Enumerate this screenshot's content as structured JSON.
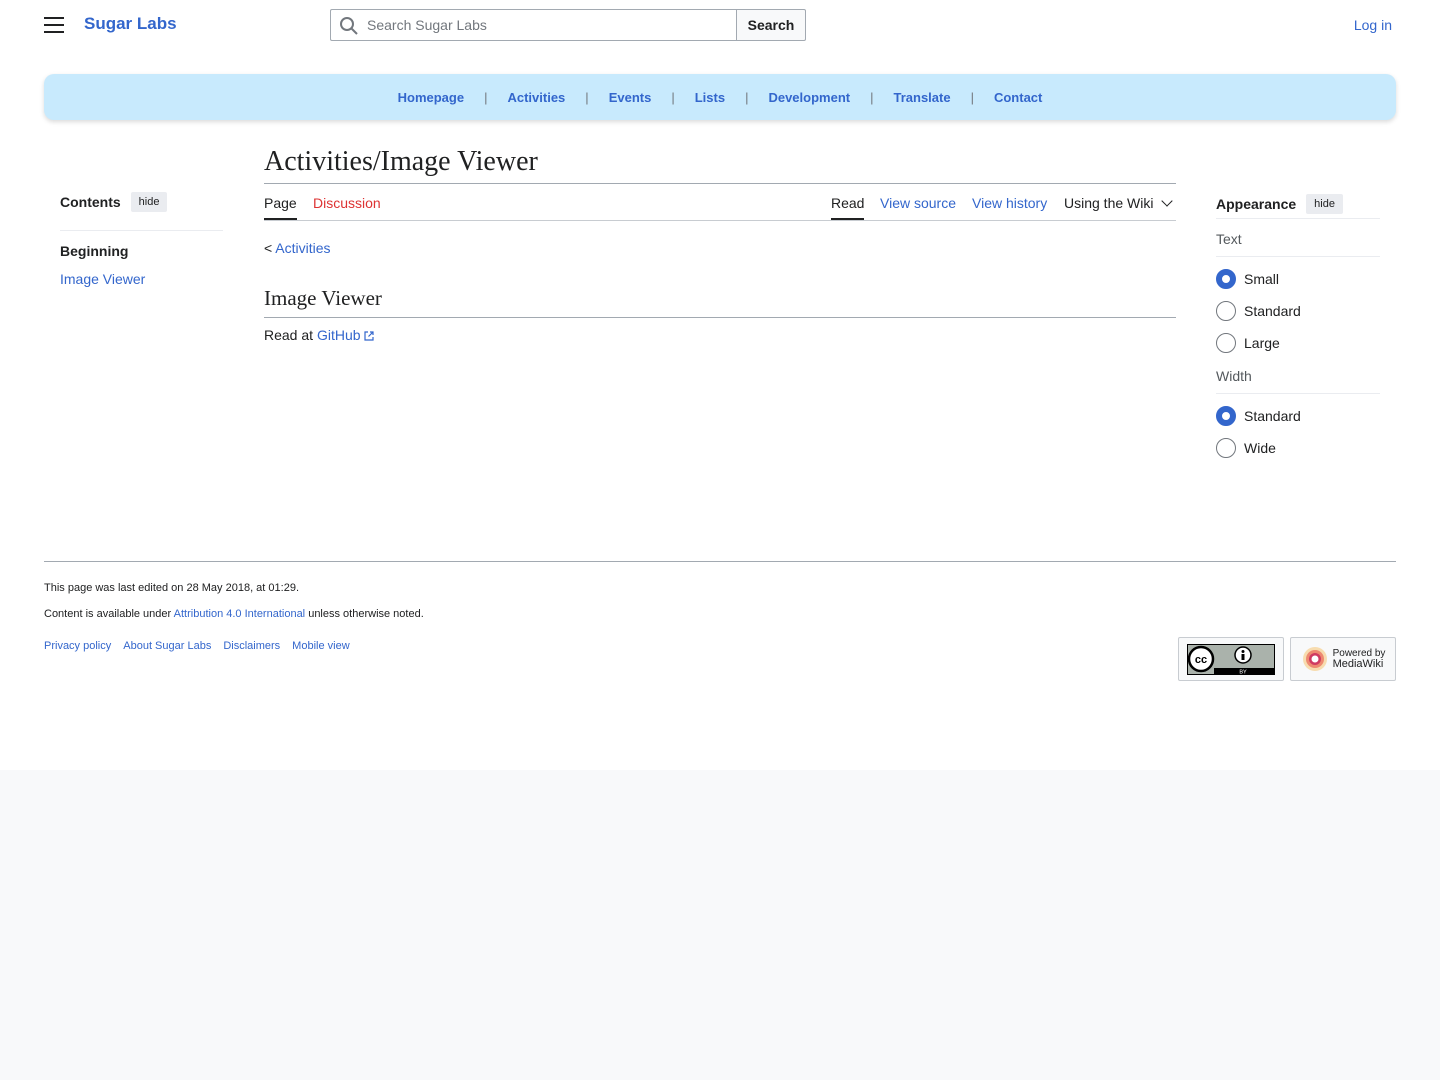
{
  "header": {
    "site_name": "Sugar Labs",
    "search_placeholder": "Search Sugar Labs",
    "search_button": "Search",
    "login": "Log in"
  },
  "topnav": {
    "items": [
      "Homepage",
      "Activities",
      "Events",
      "Lists",
      "Development",
      "Translate",
      "Contact"
    ],
    "separator": "|"
  },
  "toc": {
    "title": "Contents",
    "hide": "hide",
    "beginning": "Beginning",
    "items": [
      "Image Viewer"
    ]
  },
  "main": {
    "title": "Activities/Image Viewer",
    "tabs_left": [
      "Page",
      "Discussion"
    ],
    "tabs_right": [
      "Read",
      "View source",
      "View history",
      "Using the Wiki"
    ],
    "breadcrumb_prefix": "< ",
    "breadcrumb_link": "Activities",
    "section_heading": "Image Viewer",
    "read_at_prefix": "Read at ",
    "read_at_link": "GitHub"
  },
  "appearance": {
    "title": "Appearance",
    "hide": "hide",
    "text_label": "Text",
    "text_options": [
      "Small",
      "Standard",
      "Large"
    ],
    "text_selected": "Small",
    "width_label": "Width",
    "width_options": [
      "Standard",
      "Wide"
    ],
    "width_selected": "Standard"
  },
  "footer": {
    "last_edited": "This page was last edited on 28 May 2018, at 01:29.",
    "license_prefix": "Content is available under ",
    "license_link": "Attribution 4.0 International",
    "license_suffix": " unless otherwise noted.",
    "links": [
      "Privacy policy",
      "About Sugar Labs",
      "Disclaimers",
      "Mobile view"
    ],
    "cc_badge_label": "BY",
    "mediawiki_badge_line1": "Powered by",
    "mediawiki_badge_line2": "MediaWiki"
  },
  "colors": {
    "link": "#3366cc",
    "new_link": "#dd3333",
    "nav_bg": "#c8eafd",
    "radio_selected": "#3366cc"
  }
}
